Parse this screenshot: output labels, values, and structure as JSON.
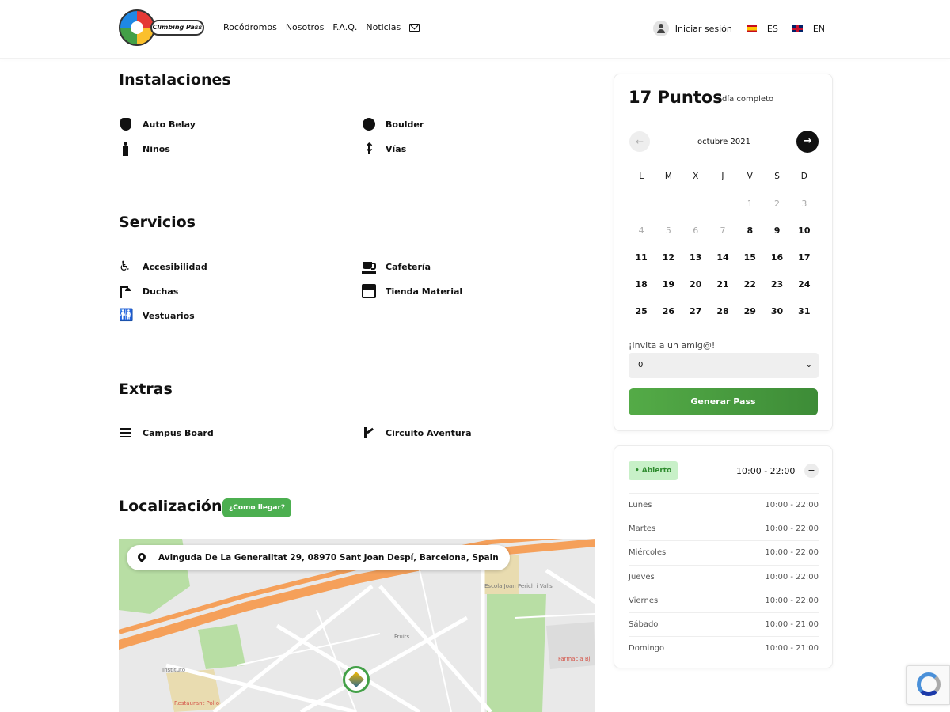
{
  "header": {
    "logo_text": "Climbing Pass",
    "nav": [
      "Rocódromos",
      "Nosotros",
      "F.A.Q.",
      "Noticias"
    ],
    "login": "Iniciar sesión",
    "lang_es": "ES",
    "lang_en": "EN"
  },
  "sections": {
    "instalaciones": {
      "title": "Instalaciones",
      "items": [
        "Auto Belay",
        "Boulder",
        "Niños",
        "Vías"
      ]
    },
    "servicios": {
      "title": "Servicios",
      "items": [
        "Accesibilidad",
        "Cafetería",
        "Duchas",
        "Tienda Material",
        "Vestuarios"
      ]
    },
    "extras": {
      "title": "Extras",
      "items": [
        "Campus Board",
        "Circuito Aventura"
      ]
    },
    "localizacion": {
      "title": "Localización",
      "how_to_get": "¿Como llegar?",
      "address": "Avinguda De La Generalitat 29, 08970 Sant Joan Despí, Barcelona, Spain",
      "map_labels": [
        "Escola Joan Perich i Valls",
        "Farmacia Bj",
        "Restaurant Pollo",
        "Instituto",
        "Fruits"
      ]
    }
  },
  "booking": {
    "points": "17 Puntos",
    "points_sub": "día completo",
    "month": "octubre 2021",
    "weekdays": [
      "L",
      "M",
      "X",
      "J",
      "V",
      "S",
      "D"
    ],
    "weeks": [
      [
        "",
        "",
        "",
        "",
        "1",
        "2",
        "3"
      ],
      [
        "4",
        "5",
        "6",
        "7",
        "8",
        "9",
        "10"
      ],
      [
        "11",
        "12",
        "13",
        "14",
        "15",
        "16",
        "17"
      ],
      [
        "18",
        "19",
        "20",
        "21",
        "22",
        "23",
        "24"
      ],
      [
        "25",
        "26",
        "27",
        "28",
        "29",
        "30",
        "31"
      ]
    ],
    "invite_label": "¡Invita a un amig@!",
    "invite_value": "0",
    "generate": "Generar Pass"
  },
  "hours": {
    "status": "Abierto",
    "today": "10:00 - 22:00",
    "days": [
      {
        "day": "Lunes",
        "time": "10:00 - 22:00"
      },
      {
        "day": "Martes",
        "time": "10:00 - 22:00"
      },
      {
        "day": "Miércoles",
        "time": "10:00 - 22:00"
      },
      {
        "day": "Jueves",
        "time": "10:00 - 22:00"
      },
      {
        "day": "Viernes",
        "time": "10:00 - 22:00"
      },
      {
        "day": "Sábado",
        "time": "10:00 - 21:00"
      },
      {
        "day": "Domingo",
        "time": "10:00 - 21:00"
      }
    ]
  },
  "colors": {
    "accent_green": "#4caf50",
    "open_bg": "#c8f0c8",
    "road_orange": "#f5a05a"
  }
}
